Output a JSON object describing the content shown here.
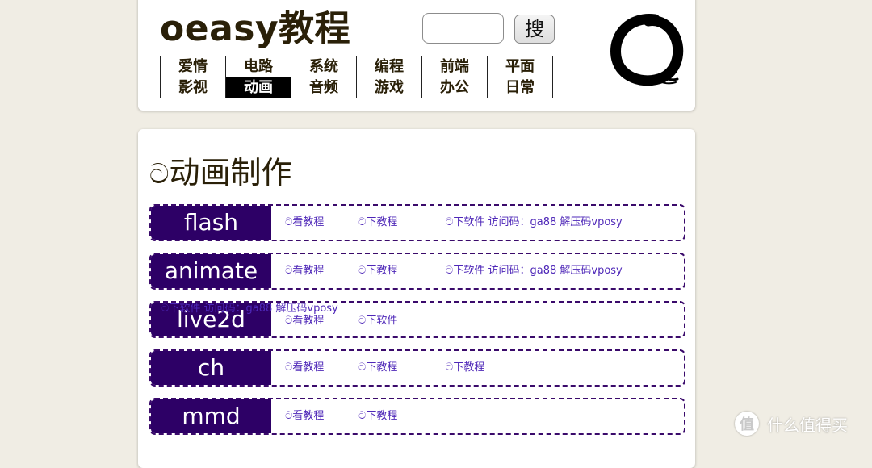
{
  "header": {
    "site_title": "oeasy教程",
    "search": {
      "value": "",
      "button_label": "搜"
    },
    "nav": [
      {
        "label": "爱情",
        "active": false
      },
      {
        "label": "电路",
        "active": false
      },
      {
        "label": "系统",
        "active": false
      },
      {
        "label": "编程",
        "active": false
      },
      {
        "label": "前端",
        "active": false
      },
      {
        "label": "平面",
        "active": false
      },
      {
        "label": "影视",
        "active": false
      },
      {
        "label": "动画",
        "active": true
      },
      {
        "label": "音频",
        "active": false
      },
      {
        "label": "游戏",
        "active": false
      },
      {
        "label": "办公",
        "active": false
      },
      {
        "label": "日常",
        "active": false
      }
    ]
  },
  "section": {
    "icon": "spiral-icon",
    "icon_glyph": "\u0001",
    "title": "动画制作",
    "rows": [
      {
        "label": "flash",
        "links": [
          "ට看教程",
          "ට下教程",
          "ට下软件 访问码：ga88 解压码vposy"
        ]
      },
      {
        "label": "animate",
        "links": [
          "ට看教程",
          "ට下教程",
          "ට下软件 访问码：ga88 解压码vposy"
        ]
      },
      {
        "label": "live2d",
        "links": [
          "ට看教程",
          "ට下软件"
        ]
      },
      {
        "label": "ch",
        "links": [
          "ට看教程",
          "ට下教程",
          "ට下教程"
        ]
      },
      {
        "label": "mmd",
        "links": [
          "ට看教程",
          "ට下教程"
        ]
      }
    ],
    "overflow_text": "ට下软件 访问码：ga88 解压码vposy"
  },
  "watermark": {
    "glyph": "值",
    "text": "什么值得买"
  },
  "colors": {
    "page_bg": "#f0ede4",
    "label_bg": "#2d0066",
    "link": "#4e27b8",
    "dashed_border": "#3a0a6b",
    "title": "#2a2008"
  }
}
